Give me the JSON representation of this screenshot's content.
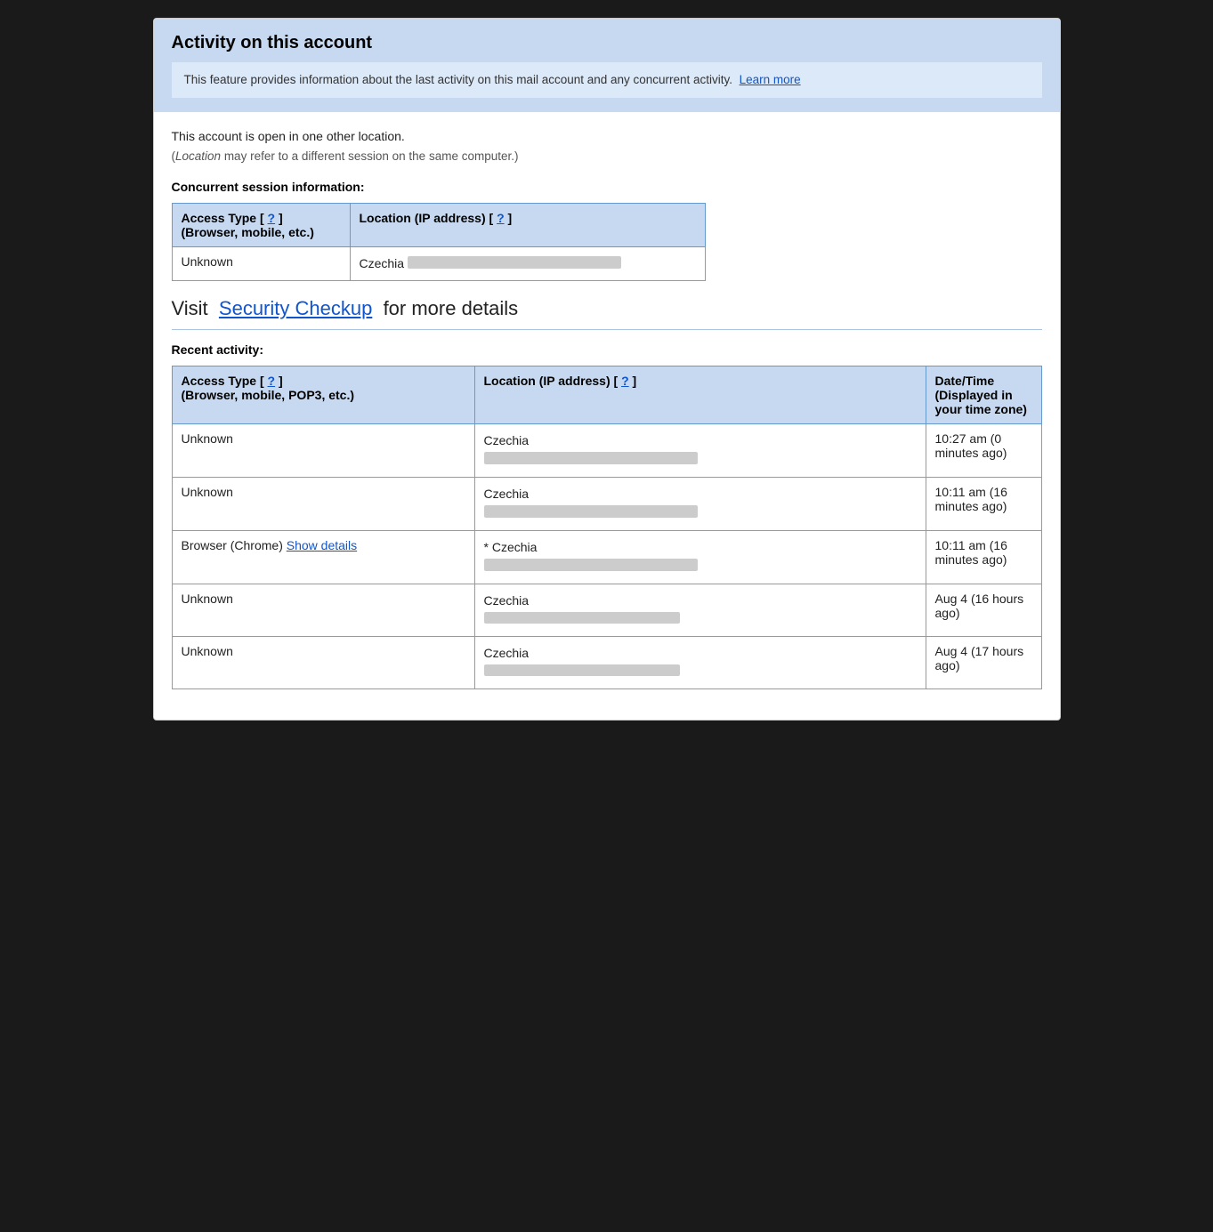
{
  "header": {
    "title": "Activity on this account",
    "description": "This feature provides information about the last activity on this mail account and any concurrent activity.",
    "learn_more_label": "Learn more"
  },
  "account_status": {
    "open_text": "This account is open in one other location.",
    "location_note": "(Location may refer to a different session on the same computer.)"
  },
  "concurrent_section": {
    "label": "Concurrent session information:",
    "table": {
      "headers": [
        {
          "label": "Access Type [",
          "link": "?",
          "link_label": "?",
          "suffix": " ]",
          "sub": "(Browser, mobile, etc.)"
        },
        {
          "label": "Location (IP address) [",
          "link": "?",
          "link_label": "?",
          "suffix": " ]"
        }
      ],
      "rows": [
        {
          "access_type": "Unknown",
          "location": "Czechia",
          "ip_blurred": true
        }
      ]
    }
  },
  "security_checkup": {
    "pre": "Visit",
    "link": "Security Checkup",
    "post": "for more details"
  },
  "recent_section": {
    "label": "Recent activity:",
    "table": {
      "headers": [
        {
          "label": "Access Type [",
          "link_label": "?",
          "suffix": " ]",
          "sub": "(Browser, mobile, POP3, etc.)"
        },
        {
          "label": "Location (IP address) [",
          "link_label": "?",
          "suffix": " ]"
        },
        {
          "label": "Date/Time",
          "sub": "(Displayed in your time zone)"
        }
      ],
      "rows": [
        {
          "access_type": "Unknown",
          "location": "Czechia",
          "ip_blurred": true,
          "datetime": "10:27 am (0 minutes ago)"
        },
        {
          "access_type": "Unknown",
          "location": "Czechia",
          "ip_blurred": true,
          "datetime": "10:11 am (16 minutes ago)"
        },
        {
          "access_type": "Browser (Chrome)",
          "access_link": "Show details",
          "location": "* Czechia",
          "ip_blurred": true,
          "datetime": "10:11 am (16 minutes ago)"
        },
        {
          "access_type": "Unknown",
          "location": "Czechia",
          "ip_blurred": true,
          "ip_variant": "sm",
          "datetime": "Aug 4 (16 hours ago)"
        },
        {
          "access_type": "Unknown",
          "location": "Czechia",
          "ip_blurred": true,
          "ip_variant": "sm",
          "datetime": "Aug 4 (17 hours ago)"
        }
      ]
    }
  }
}
